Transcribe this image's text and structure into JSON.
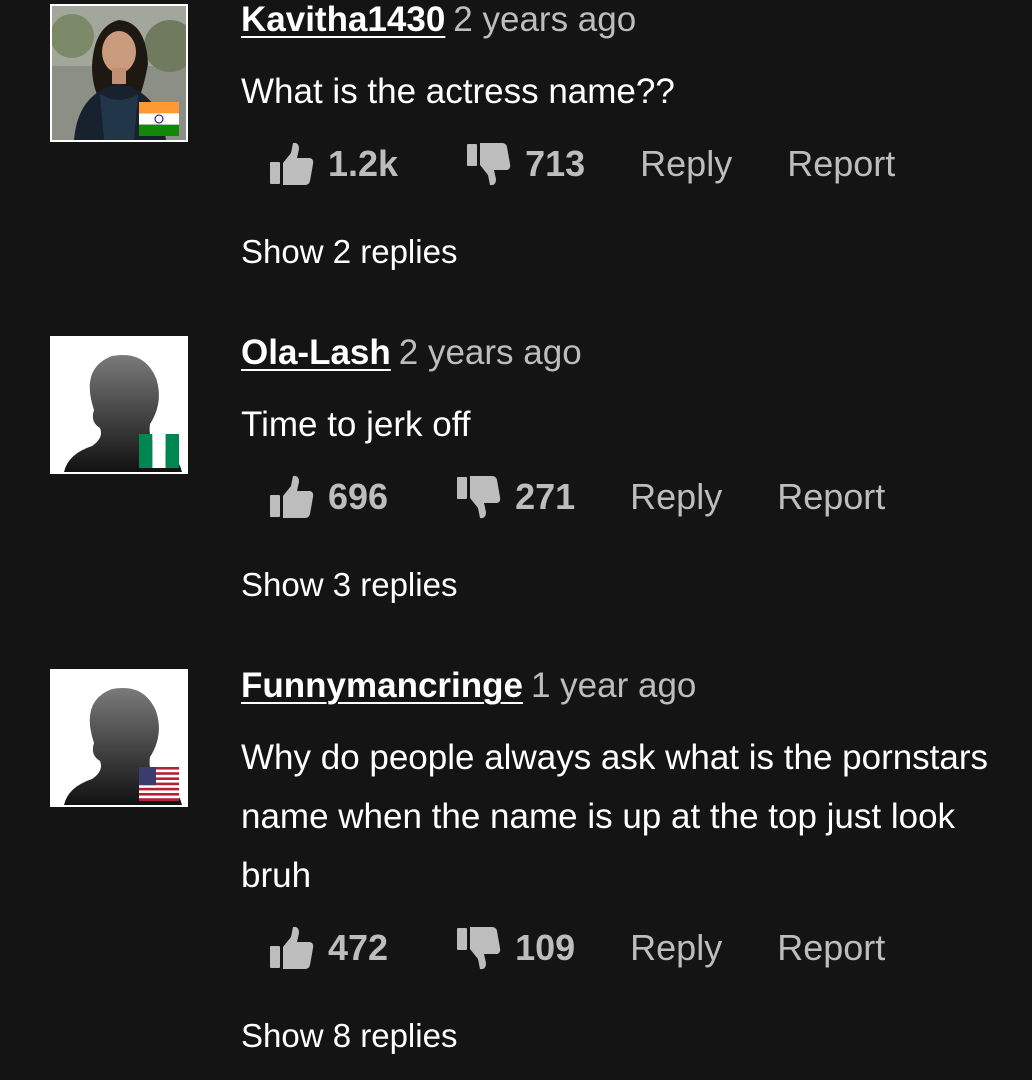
{
  "comments": [
    {
      "username": "Kavitha1430",
      "time_ago": "2 years ago",
      "text": "What is the actress name??",
      "likes": "1.2k",
      "dislikes": "713",
      "reply_label": "Reply",
      "report_label": "Report",
      "show_replies": "Show 2 replies",
      "avatar": "profile-photo",
      "flag": "india-flag"
    },
    {
      "username": "Ola-Lash",
      "time_ago": "2 years ago",
      "text": "Time to jerk off",
      "likes": "696",
      "dislikes": "271",
      "reply_label": "Reply",
      "report_label": "Report",
      "show_replies": "Show 3 replies",
      "avatar": "default-silhouette",
      "flag": "nigeria-flag"
    },
    {
      "username": "Funnymancringe",
      "time_ago": "1 year ago",
      "text": "Why do people always ask what is the pornstars name when the name is up at the top just look bruh",
      "likes": "472",
      "dislikes": "109",
      "reply_label": "Reply",
      "report_label": "Report",
      "show_replies": "Show 8 replies",
      "avatar": "default-silhouette",
      "flag": "usa-flag"
    }
  ],
  "colors": {
    "background": "#141414",
    "text": "#ffffff",
    "muted": "#bdbdbd"
  }
}
